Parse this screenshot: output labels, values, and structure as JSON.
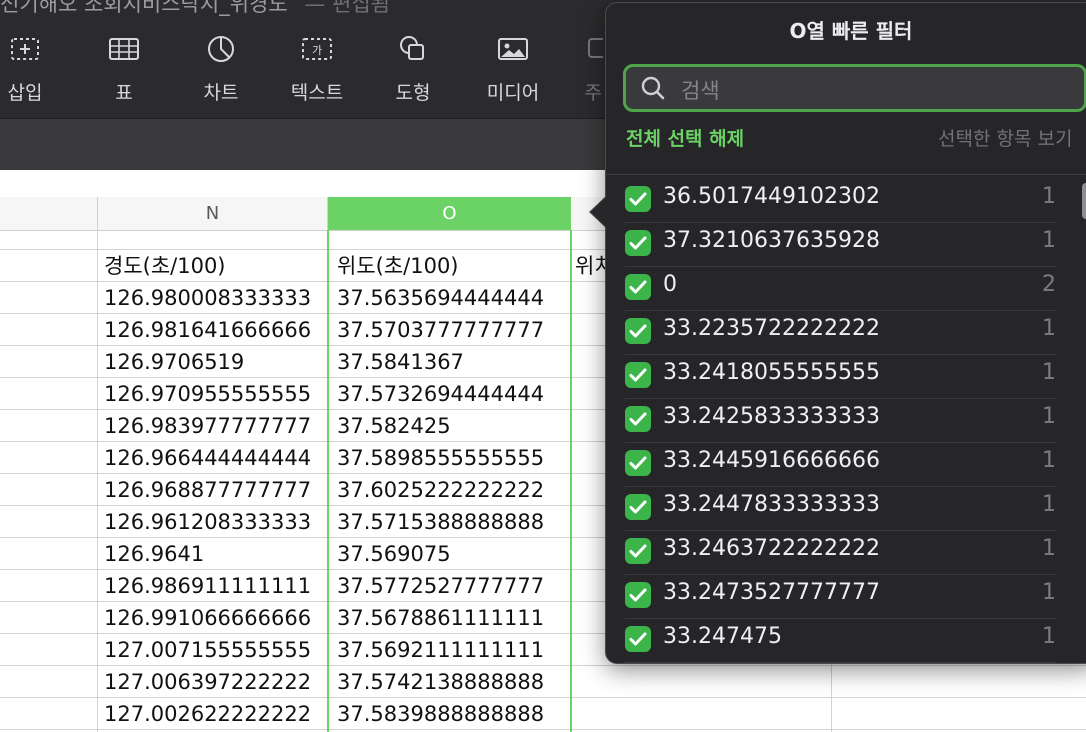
{
  "doc": {
    "title": "전기해오 조회지비스락지_위경도",
    "status": "편집됨"
  },
  "toolbar": {
    "items": [
      {
        "label": "삽입",
        "icon": "insert-icon"
      },
      {
        "label": "표",
        "icon": "table-icon"
      },
      {
        "label": "차트",
        "icon": "chart-icon"
      },
      {
        "label": "텍스트",
        "icon": "text-box-icon"
      },
      {
        "label": "도형",
        "icon": "shape-icon"
      },
      {
        "label": "미디어",
        "icon": "media-icon"
      },
      {
        "label": "주",
        "icon": "comment-icon"
      }
    ]
  },
  "sheet": {
    "columns": [
      {
        "name": "N"
      },
      {
        "name": "O"
      }
    ],
    "headers": {
      "n": "경도(초/100)",
      "o": "위도(초/100)",
      "p": "위치"
    },
    "rows": [
      [
        "126.980008333333",
        "37.5635694444444"
      ],
      [
        "126.981641666666",
        "37.5703777777777"
      ],
      [
        "126.9706519",
        "37.5841367"
      ],
      [
        "126.970955555555",
        "37.5732694444444"
      ],
      [
        "126.983977777777",
        "37.582425"
      ],
      [
        "126.966444444444",
        "37.5898555555555"
      ],
      [
        "126.968877777777",
        "37.6025222222222"
      ],
      [
        "126.961208333333",
        "37.5715388888888"
      ],
      [
        "126.9641",
        "37.569075"
      ],
      [
        "126.986911111111",
        "37.5772527777777"
      ],
      [
        "126.991066666666",
        "37.5678861111111"
      ],
      [
        "127.007155555555",
        "37.5692111111111"
      ],
      [
        "127.006397222222",
        "37.5742138888888"
      ],
      [
        "127.002622222222",
        "37.5839888888888"
      ]
    ]
  },
  "filter": {
    "title": "O열 빠른 필터",
    "search_placeholder": "검색",
    "deselect_all": "전체 선택 해제",
    "show_selected": "선택한 항목 보기",
    "items": [
      {
        "value": "36.5017449102302",
        "count": "1",
        "checked": true
      },
      {
        "value": "37.3210637635928",
        "count": "1",
        "checked": true
      },
      {
        "value": "0",
        "count": "2",
        "checked": true
      },
      {
        "value": "33.2235722222222",
        "count": "1",
        "checked": true
      },
      {
        "value": "33.2418055555555",
        "count": "1",
        "checked": true
      },
      {
        "value": "33.2425833333333",
        "count": "1",
        "checked": true
      },
      {
        "value": "33.2445916666666",
        "count": "1",
        "checked": true
      },
      {
        "value": "33.2447833333333",
        "count": "1",
        "checked": true
      },
      {
        "value": "33.2463722222222",
        "count": "1",
        "checked": true
      },
      {
        "value": "33.2473527777777",
        "count": "1",
        "checked": true
      },
      {
        "value": "33.247475",
        "count": "1",
        "checked": true
      }
    ]
  },
  "colors": {
    "accent": "#6bd365",
    "checkbox": "#3bb44a"
  }
}
